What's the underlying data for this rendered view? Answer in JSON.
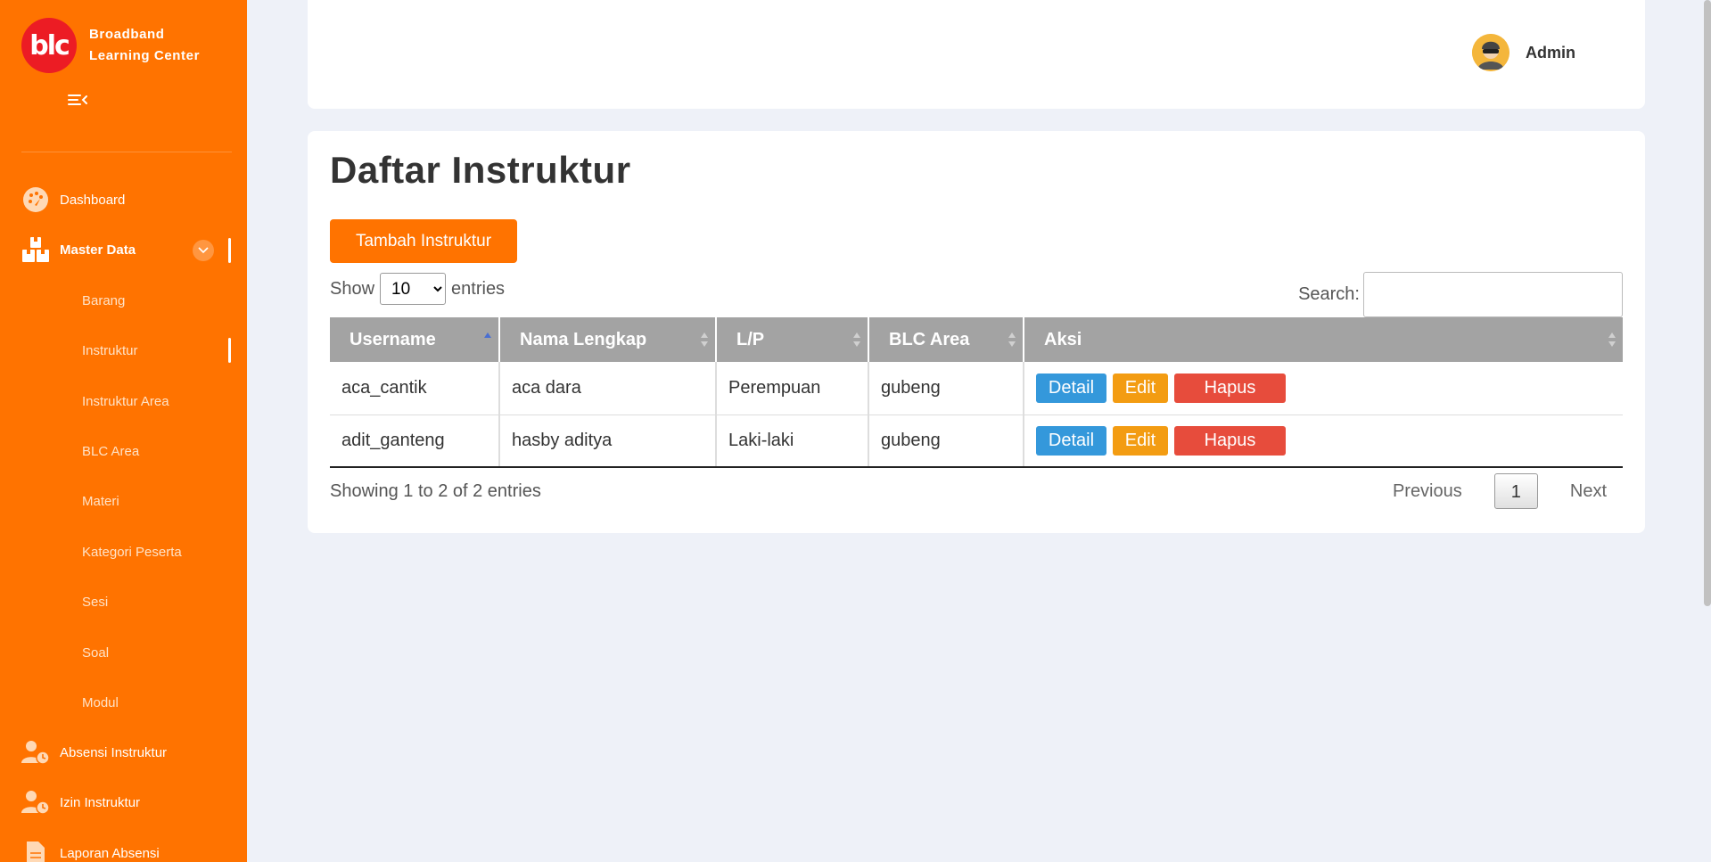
{
  "brand": {
    "logo_text": "blc",
    "line1": "Broadband",
    "line2": "Learning Center"
  },
  "sidebar": {
    "items": [
      {
        "label": "Dashboard",
        "icon": "dashboard-gauge-icon"
      },
      {
        "label": "Master Data",
        "icon": "boxes-icon"
      },
      {
        "label": "Barang"
      },
      {
        "label": "Instruktur"
      },
      {
        "label": "Instruktur Area"
      },
      {
        "label": "BLC Area"
      },
      {
        "label": "Materi"
      },
      {
        "label": "Kategori Peserta"
      },
      {
        "label": "Sesi"
      },
      {
        "label": "Soal"
      },
      {
        "label": "Modul"
      },
      {
        "label": "Absensi Instruktur",
        "icon": "user-clock-icon"
      },
      {
        "label": "Izin Instruktur",
        "icon": "user-clock-icon"
      },
      {
        "label": "Laporan Absensi",
        "icon": "file-icon"
      }
    ]
  },
  "header": {
    "user_name": "Admin"
  },
  "main": {
    "title": "Daftar Instruktur",
    "add_button": "Tambah Instruktur",
    "length": {
      "before": "Show",
      "selected": "10",
      "after": "entries"
    },
    "search_label": "Search:",
    "columns": [
      "Username",
      "Nama Lengkap",
      "L/P",
      "BLC Area",
      "Aksi"
    ],
    "rows": [
      {
        "username": "aca_cantik",
        "nama": "aca dara",
        "lp": "Perempuan",
        "area": "gubeng"
      },
      {
        "username": "adit_ganteng",
        "nama": "hasby aditya",
        "lp": "Laki-laki",
        "area": "gubeng"
      }
    ],
    "actions": {
      "detail": "Detail",
      "edit": "Edit",
      "hapus": "Hapus"
    },
    "info": "Showing 1 to 2 of 2 entries",
    "pagination": {
      "previous": "Previous",
      "current": "1",
      "next": "Next"
    }
  },
  "colors": {
    "primary": "#ff7300",
    "detail": "#3498db",
    "edit": "#f39c12",
    "hapus": "#e74c3c",
    "table_header": "#a3a3a3"
  }
}
